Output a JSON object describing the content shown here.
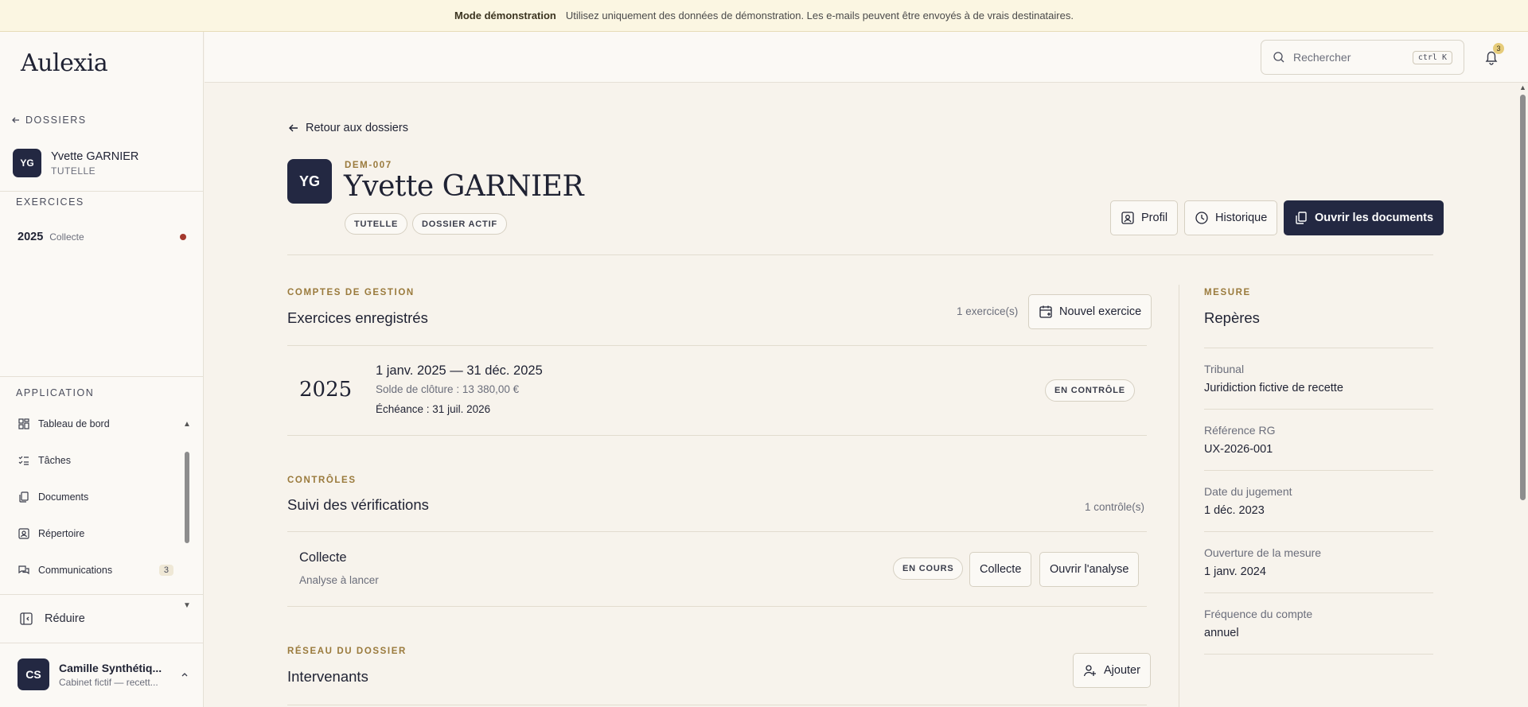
{
  "banner": {
    "mode": "Mode démonstration",
    "message": "Utilisez uniquement des données de démonstration. Les e-mails peuvent être envoyés à de vrais destinataires."
  },
  "sidebar": {
    "logo": "Aulexia",
    "back_label": "DOSSIERS",
    "client": {
      "initials": "YG",
      "name": "Yvette GARNIER",
      "type": "TUTELLE"
    },
    "exercices_label": "EXERCICES",
    "exercice": {
      "year": "2025",
      "status": "Collecte"
    },
    "application_label": "APPLICATION",
    "nav": [
      {
        "label": "Tableau de bord",
        "icon": "dashboard-icon"
      },
      {
        "label": "Tâches",
        "icon": "tasks-icon"
      },
      {
        "label": "Documents",
        "icon": "documents-icon"
      },
      {
        "label": "Répertoire",
        "icon": "contacts-icon"
      },
      {
        "label": "Communications",
        "icon": "chat-icon",
        "badge": "3"
      }
    ],
    "reduce_label": "Réduire",
    "user": {
      "initials": "CS",
      "name": "Camille Synthétiq...",
      "sub": "Cabinet fictif — recett..."
    }
  },
  "topbar": {
    "search_placeholder": "Rechercher",
    "shortcut": "ctrl K",
    "notifications": "3"
  },
  "header": {
    "back_link": "Retour aux dossiers",
    "initials": "YG",
    "reference": "DEM-007",
    "name": "Yvette GARNIER",
    "tags": [
      "TUTELLE",
      "DOSSIER ACTIF"
    ],
    "actions": {
      "profile": "Profil",
      "history": "Historique",
      "open_docs": "Ouvrir les documents"
    }
  },
  "comptes": {
    "eyebrow": "COMPTES DE GESTION",
    "title": "Exercices enregistrés",
    "count": "1 exercice(s)",
    "new_button": "Nouvel exercice",
    "rows": [
      {
        "year": "2025",
        "period": "1 janv. 2025 — 31 déc. 2025",
        "balance": "Solde de clôture : 13 380,00 €",
        "due": "Échéance : 31 juil. 2026",
        "status": "EN CONTRÔLE"
      }
    ]
  },
  "controles": {
    "eyebrow": "CONTRÔLES",
    "title": "Suivi des vérifications",
    "count": "1 contrôle(s)",
    "rows": [
      {
        "name": "Collecte",
        "sub": "Analyse à lancer",
        "status": "EN COURS",
        "btn_collect": "Collecte",
        "btn_analyse": "Ouvrir l'analyse"
      }
    ]
  },
  "reseau": {
    "eyebrow": "RÉSEAU DU DOSSIER",
    "title": "Intervenants",
    "add_button": "Ajouter"
  },
  "mesure": {
    "eyebrow": "MESURE",
    "title": "Repères",
    "items": [
      {
        "label": "Tribunal",
        "value": "Juridiction fictive de recette"
      },
      {
        "label": "Référence RG",
        "value": "UX-2026-001"
      },
      {
        "label": "Date du jugement",
        "value": "1 déc. 2023"
      },
      {
        "label": "Ouverture de la mesure",
        "value": "1 janv. 2024"
      },
      {
        "label": "Fréquence du compte",
        "value": "annuel"
      }
    ]
  }
}
